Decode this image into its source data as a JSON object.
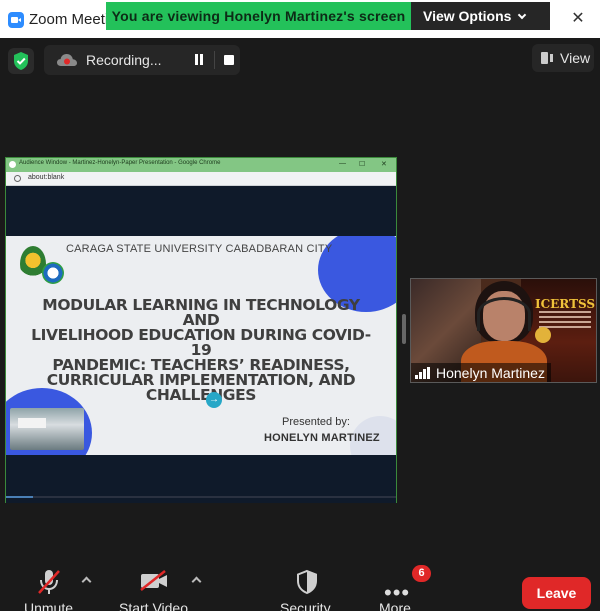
{
  "window": {
    "app_title": "Zoom Meeting",
    "minimize_glyph": "—",
    "close_glyph": "✕"
  },
  "share_banner": {
    "text": "You are viewing Honelyn Martinez's screen",
    "view_options_label": "View Options",
    "banner_color": "#23c15a"
  },
  "top_controls": {
    "recording_label": "Recording...",
    "view_label": "View",
    "security_status_color": "#23c15a"
  },
  "shared_screen": {
    "browser_title": "Audience Window - Martinez-Honelyn-Paper Presentation - Google Chrome",
    "address": "about:blank",
    "window_controls": [
      "—",
      "☐",
      "✕"
    ],
    "slide": {
      "university": "CARAGA STATE UNIVERSITY CABADBARAN CITY",
      "title_lines": [
        "MODULAR LEARNING IN TECHNOLOGY AND",
        "LIVELIHOOD EDUCATION DURING COVID-19",
        "PANDEMIC: TEACHERS’ READINESS,",
        "CURRICULAR IMPLEMENTATION, AND",
        "CHALLENGES"
      ],
      "presented_by": "Presented by:",
      "presenter": "HONELYN MARTINEZ",
      "accent_color": "#3a58e0"
    },
    "progress_fraction": 0.07
  },
  "participant_tile": {
    "name": "Honelyn Martinez",
    "background_brand": "ICERTSS"
  },
  "toolbar": {
    "unmute_label": "Unmute",
    "start_video_label": "Start Video",
    "security_label": "Security",
    "more_label": "More",
    "more_badge": "6",
    "leave_label": "Leave",
    "leave_color": "#e02828"
  }
}
